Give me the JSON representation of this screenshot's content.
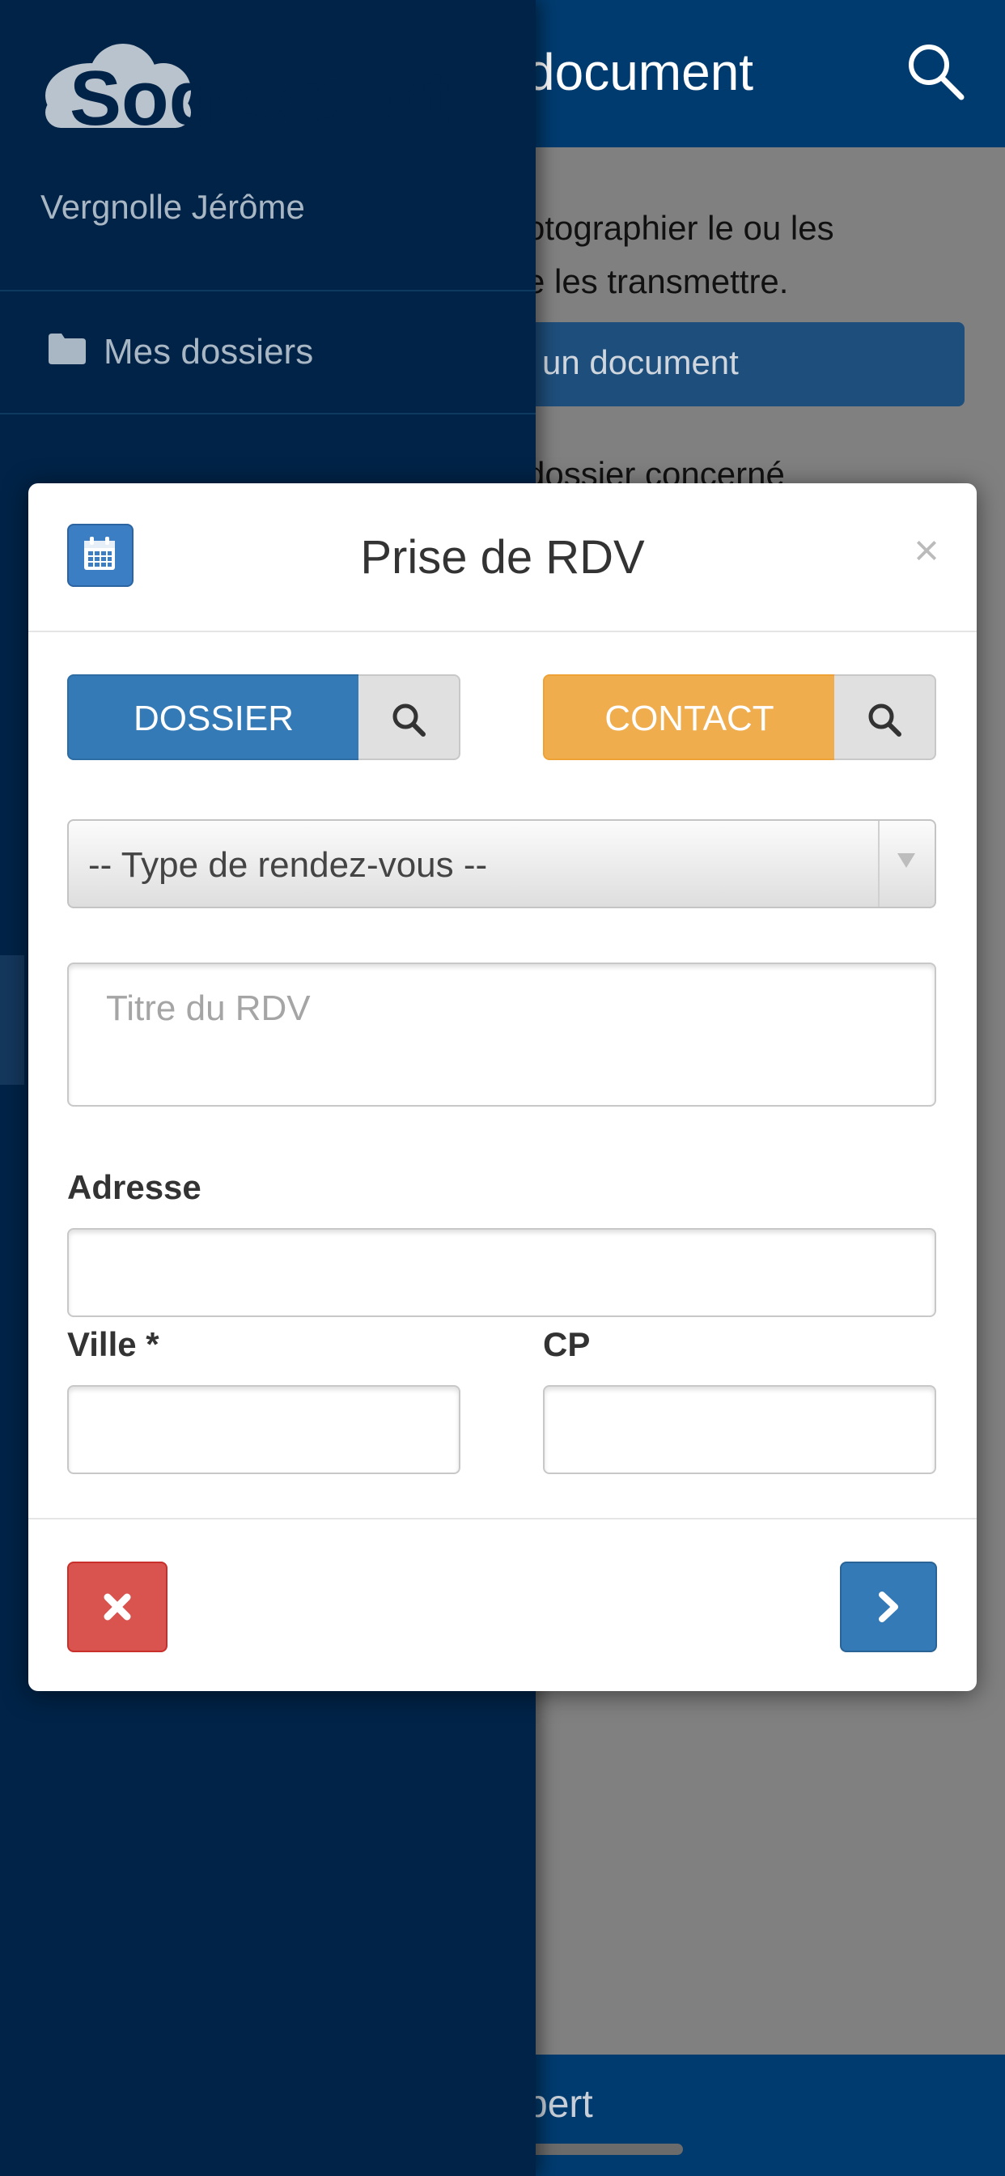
{
  "background": {
    "header_title": "document",
    "line_1": "otographier le ou les",
    "line_2": "e les transmettre.",
    "button_label": "un document",
    "line_3": "dossier concerné",
    "footer_text": "pert"
  },
  "drawer": {
    "brand": "Sogexpert",
    "user_name": "Vergnolle Jérôme",
    "items": [
      {
        "label": "Mes dossiers",
        "icon": "folder-icon"
      }
    ]
  },
  "modal": {
    "title": "Prise de RDV",
    "close_symbol": "×",
    "dossier_label": "DOSSIER",
    "contact_label": "CONTACT",
    "type_select": {
      "selected": "-- Type de rendez-vous --"
    },
    "title_placeholder": "Titre du RDV",
    "address_label": "Adresse",
    "address_value": "",
    "city_label": "Ville *",
    "city_value": "",
    "cp_label": "CP",
    "cp_value": ""
  },
  "colors": {
    "primary": "#337ab7",
    "warning": "#f0ad4e",
    "danger": "#d9534f",
    "drawer_bg": "#012347",
    "header_bg": "#003b6f"
  }
}
